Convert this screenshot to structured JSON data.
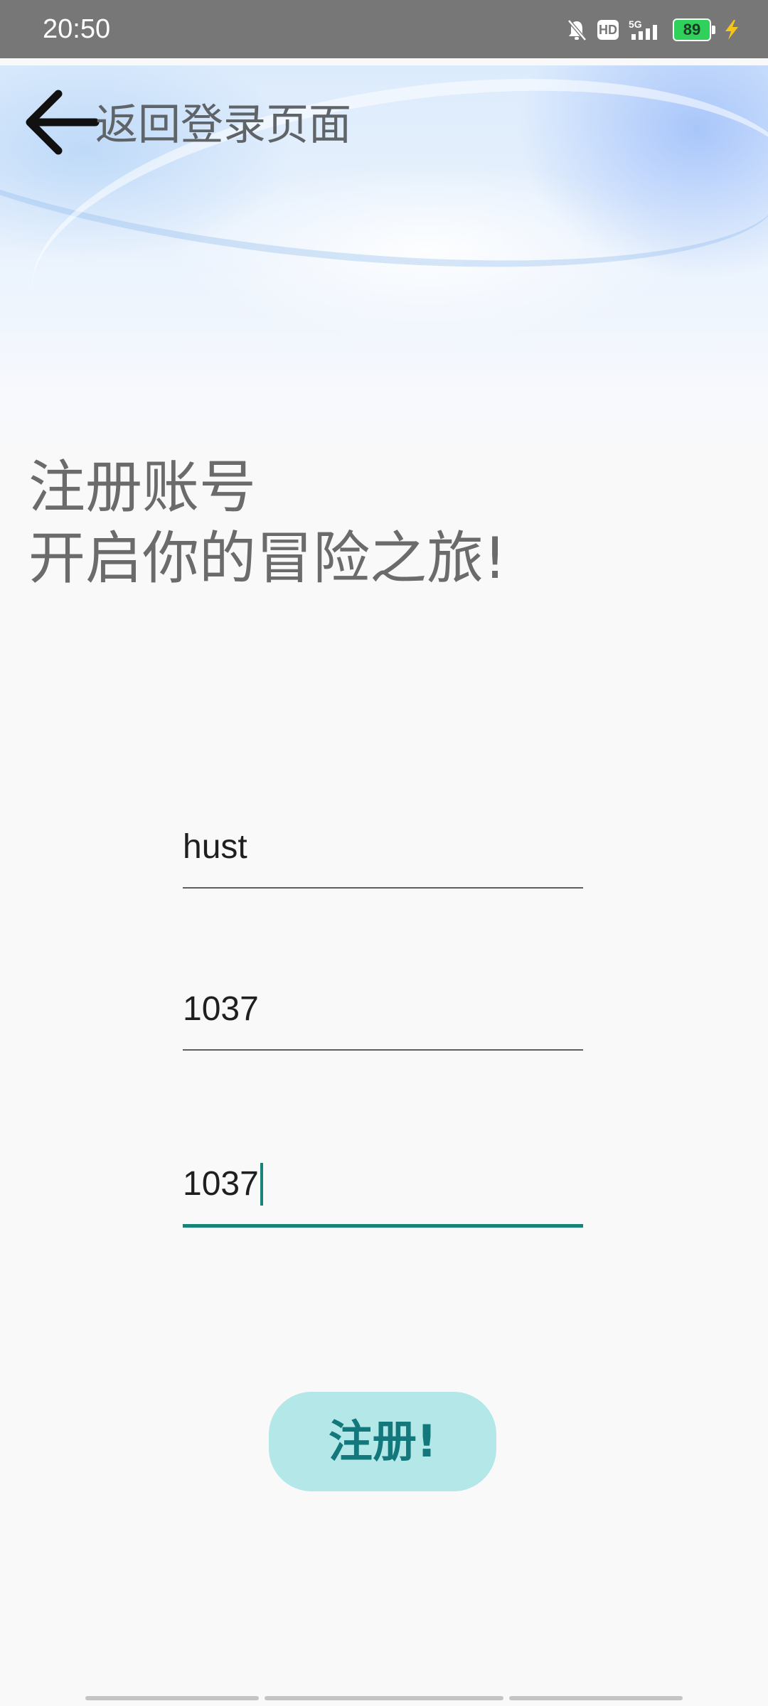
{
  "status_bar": {
    "time": "20:50",
    "hd_label": "HD",
    "network_label": "5G",
    "battery_level": "89"
  },
  "header": {
    "back_label": "返回登录页面"
  },
  "headline": {
    "line1": "注册账号",
    "line2": "开启你的冒险之旅!"
  },
  "form": {
    "username_value": "hust",
    "password_value": "1037",
    "confirm_password_value": "1037"
  },
  "register_button": {
    "label": "注册!"
  },
  "colors": {
    "accent": "#17847a",
    "button_bg": "#b3e7e8",
    "button_text": "#12787c",
    "status_bar_bg": "#777777"
  }
}
